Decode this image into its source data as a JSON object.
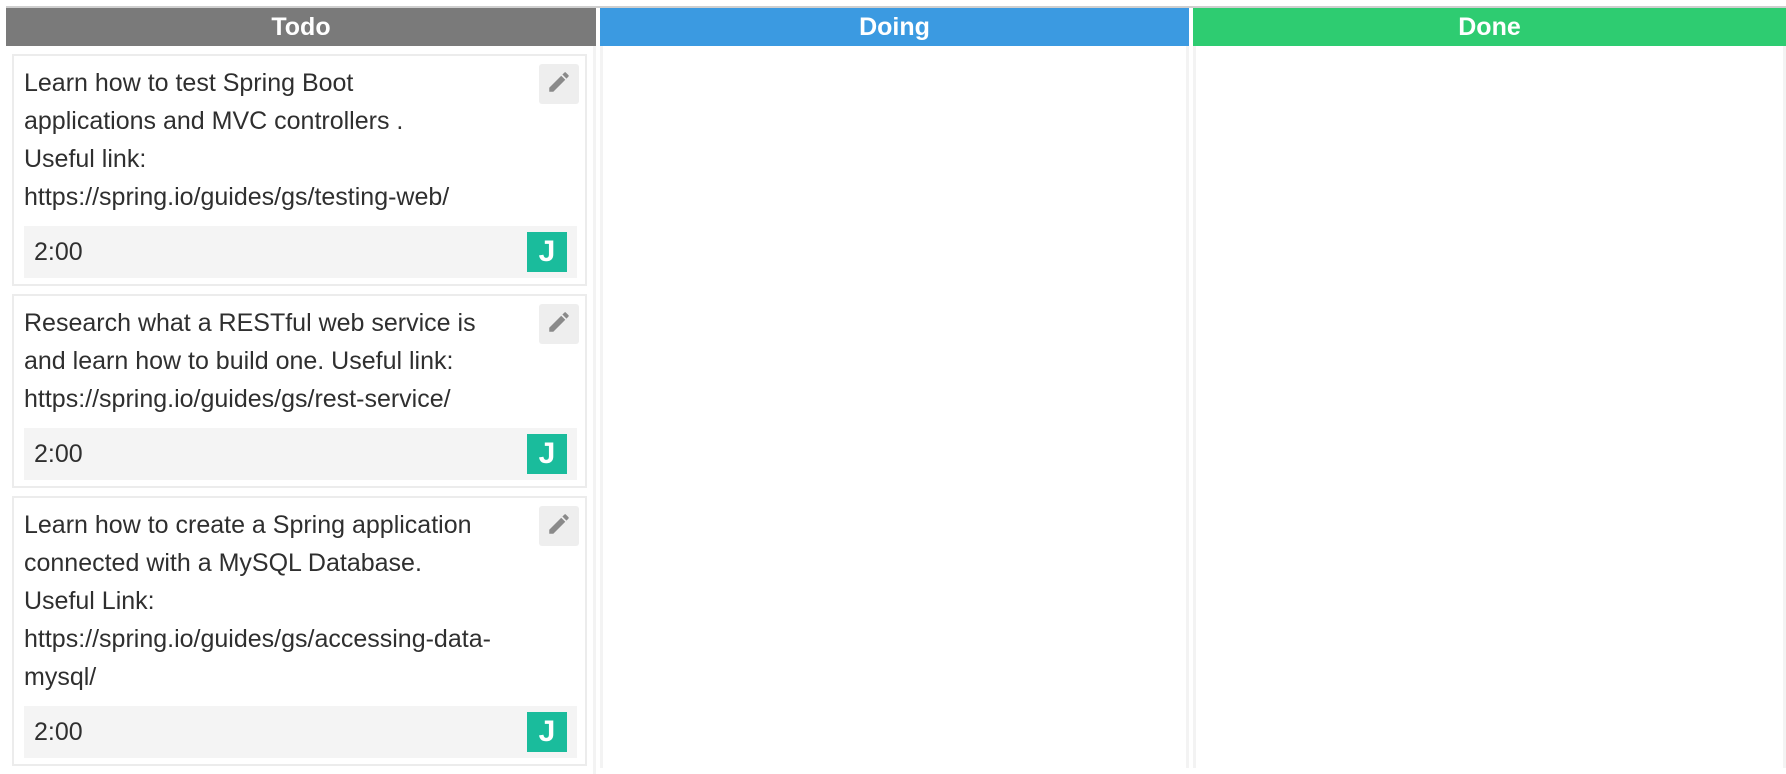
{
  "columns": [
    {
      "title": "Todo",
      "color": "#7a7a7a",
      "cards": [
        {
          "text": "Learn how to test Spring Boot\napplications and MVC controllers .\nUseful link:\nhttps://spring.io/guides/gs/testing-web/",
          "time": "2:00",
          "avatar_letter": "J",
          "edit_icon": "pencil-icon"
        },
        {
          "text": "Research what a RESTful web service is\nand learn how to build one. Useful link:\nhttps://spring.io/guides/gs/rest-service/",
          "time": "2:00",
          "avatar_letter": "J",
          "edit_icon": "pencil-icon"
        },
        {
          "text": "Learn how to create a Spring application\nconnected with a MySQL Database.\nUseful Link:\nhttps://spring.io/guides/gs/accessing-data-\nmysql/",
          "time": "2:00",
          "avatar_letter": "J",
          "edit_icon": "pencil-icon"
        }
      ]
    },
    {
      "title": "Doing",
      "color": "#3b9ae1",
      "cards": []
    },
    {
      "title": "Done",
      "color": "#2ecc71",
      "cards": []
    }
  ],
  "avatar_color": "#1abc9c"
}
